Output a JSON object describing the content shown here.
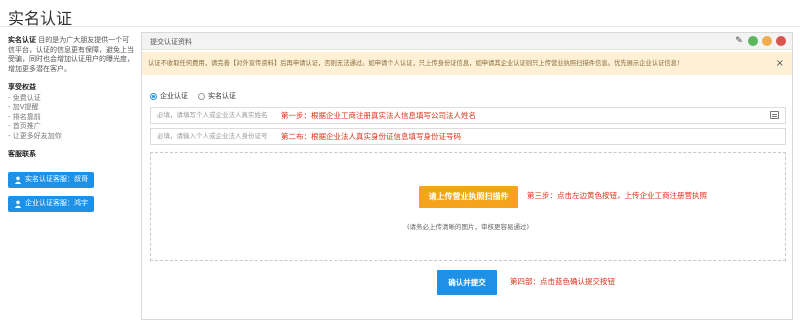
{
  "page": {
    "title": "实名认证"
  },
  "sidebar": {
    "intro_bold": "实名认证",
    "intro": "目的是为广大朋友提供一个可信平台，认证的信息更有保障，避免上当受骗，同时也会增加认证用户的曝光度，增加更多潜在客户。",
    "benefits_title": "享受权益",
    "benefits": [
      "- 免费认证",
      "- 加V提醒",
      "- 排名靠前",
      "- 首页推广",
      "- 让更多好友加你"
    ],
    "contact_title": "客服联系",
    "contacts": [
      {
        "label": "实名认证客服：叔哥"
      },
      {
        "label": "企业认证客服：鸿宇"
      }
    ]
  },
  "panel": {
    "title": "提交认证资料",
    "notice": "认证不收取任何费用，请完善【对外宣传资料】后再申请认证，否则无法通过。如申请个人认证，只上传身份证信息，如申请其企业认证则只上传营业执照扫描件信息。优先展示企业认证信息！",
    "notice_close": "×",
    "radio_enterprise": "企业认证",
    "radio_personal": "实名认证",
    "name_placeholder": "必填，请填写个人或企业法人真实姓名",
    "name_hint": "第一步：根据企业工商注册真实法人信息填写公司法人姓名",
    "id_placeholder": "必填，请输入个人或企业法人身份证号",
    "id_hint": "第二布：根据企业法人真实身份证信息填写身份证号码",
    "upload_button": "请上传营业执照扫描件",
    "upload_hint": "第三步：点击左边黄色按钮，上传企业工商注册营执照",
    "upload_note": "(请务必上传清晰的图片，审核更容易通过)",
    "submit_button": "确认并提交",
    "submit_hint": "第四部：点击蓝色确认提交按钮"
  }
}
